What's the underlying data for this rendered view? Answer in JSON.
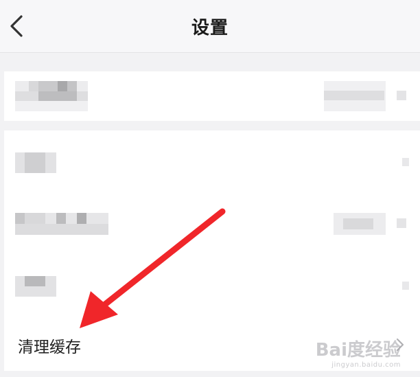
{
  "header": {
    "title": "设置"
  },
  "rows": {
    "clear_cache_label": "清理缓存"
  },
  "colors": {
    "arrow": "#f0262a",
    "background": "#f2f2f4",
    "card": "#ffffff"
  },
  "icons": {
    "back": "chevron-left-icon",
    "row_chevron": "chevron-right-icon"
  },
  "watermark": {
    "brand": "Bai度经验",
    "url": "jingyan.baidu.com"
  }
}
